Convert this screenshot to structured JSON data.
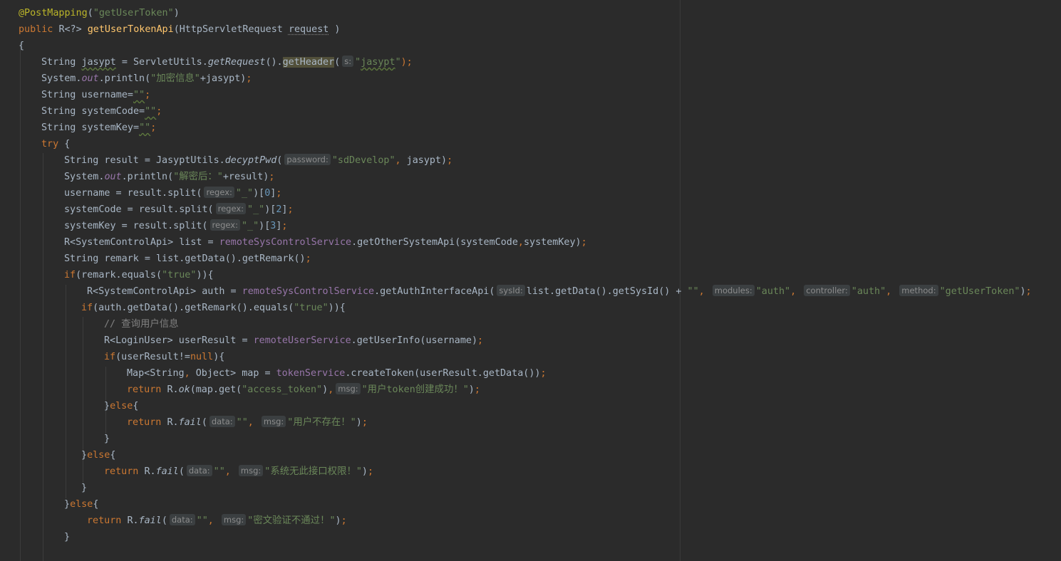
{
  "colors": {
    "background": "#2b2b2b",
    "default_text": "#a9b7c6",
    "keyword": "#cc7832",
    "string": "#6a8759",
    "number": "#6897bb",
    "annotation": "#bbb529",
    "field": "#9876aa",
    "method_declaration": "#ffc66d",
    "comment": "#808080",
    "inlay_hint_background": "#3b3f41"
  },
  "lines": [
    {
      "indent": 26,
      "tokens": [
        {
          "t": "@PostMapping",
          "c": "ann"
        },
        {
          "t": "(",
          "c": ""
        },
        {
          "t": "\"getUserToken\"",
          "c": "str"
        },
        {
          "t": ")",
          "c": ""
        }
      ]
    },
    {
      "indent": 26,
      "tokens": [
        {
          "t": "public ",
          "c": "kw"
        },
        {
          "t": "R<?> ",
          "c": ""
        },
        {
          "t": "getUserTokenApi",
          "c": "meth"
        },
        {
          "t": "(HttpServletRequest ",
          "c": ""
        },
        {
          "t": "request",
          "c": "dot"
        },
        {
          "t": " )",
          "c": ""
        }
      ]
    },
    {
      "indent": 26,
      "tokens": [
        {
          "t": "{",
          "c": ""
        }
      ]
    },
    {
      "indent": 58,
      "tokens": [
        {
          "t": "String ",
          "c": ""
        },
        {
          "t": "jasypt",
          "c": "wavy"
        },
        {
          "t": " = ServletUtils.",
          "c": ""
        },
        {
          "t": "getRequest",
          "c": "it"
        },
        {
          "t": "().",
          "c": ""
        },
        {
          "t": "getHeader",
          "c": "hl"
        },
        {
          "t": "(",
          "c": ""
        },
        {
          "h": "s:"
        },
        {
          "t": "\"",
          "c": "str"
        },
        {
          "t": "jasypt",
          "c": "str wavy"
        },
        {
          "t": "\"",
          "c": "str"
        },
        {
          "t": ");",
          "c": "kw"
        }
      ]
    },
    {
      "indent": 58,
      "tokens": [
        {
          "t": "System.",
          "c": ""
        },
        {
          "t": "out",
          "c": "fldi"
        },
        {
          "t": ".println(",
          "c": ""
        },
        {
          "t": "\"加密信息\"",
          "c": "str"
        },
        {
          "t": "+jasypt)",
          "c": ""
        },
        {
          "t": ";",
          "c": "kw"
        }
      ]
    },
    {
      "indent": 58,
      "tokens": [
        {
          "t": "String username=",
          "c": ""
        },
        {
          "t": "\"\"",
          "c": "str wavy"
        },
        {
          "t": ";",
          "c": "kw"
        }
      ]
    },
    {
      "indent": 58,
      "tokens": [
        {
          "t": "String systemCode=",
          "c": ""
        },
        {
          "t": "\"\"",
          "c": "str wavy"
        },
        {
          "t": ";",
          "c": "kw"
        }
      ]
    },
    {
      "indent": 58,
      "tokens": [
        {
          "t": "String systemKey=",
          "c": ""
        },
        {
          "t": "\"\"",
          "c": "str wavy"
        },
        {
          "t": ";",
          "c": "kw"
        }
      ]
    },
    {
      "indent": 58,
      "tokens": [
        {
          "t": "try ",
          "c": "kw"
        },
        {
          "t": "{",
          "c": ""
        }
      ]
    },
    {
      "indent": 90,
      "tokens": [
        {
          "t": "String result = JasyptUtils.",
          "c": ""
        },
        {
          "t": "decyptPwd",
          "c": "it"
        },
        {
          "t": "(",
          "c": ""
        },
        {
          "h": "password:"
        },
        {
          "t": "\"sdDevelop\"",
          "c": "str"
        },
        {
          "t": ", ",
          "c": "kw"
        },
        {
          "t": "jasypt)",
          "c": ""
        },
        {
          "t": ";",
          "c": "kw"
        }
      ]
    },
    {
      "indent": 90,
      "tokens": [
        {
          "t": "System.",
          "c": ""
        },
        {
          "t": "out",
          "c": "fldi"
        },
        {
          "t": ".println(",
          "c": ""
        },
        {
          "t": "\"解密后：\"",
          "c": "str"
        },
        {
          "t": "+result)",
          "c": ""
        },
        {
          "t": ";",
          "c": "kw"
        }
      ]
    },
    {
      "indent": 90,
      "tokens": [
        {
          "t": "username = result.split(",
          "c": ""
        },
        {
          "h": "regex:"
        },
        {
          "t": "\"_\"",
          "c": "str"
        },
        {
          "t": ")[",
          "c": ""
        },
        {
          "t": "0",
          "c": "num"
        },
        {
          "t": "]",
          "c": ""
        },
        {
          "t": ";",
          "c": "kw"
        }
      ]
    },
    {
      "indent": 90,
      "tokens": [
        {
          "t": "systemCode = result.split(",
          "c": ""
        },
        {
          "h": "regex:"
        },
        {
          "t": "\"_\"",
          "c": "str"
        },
        {
          "t": ")[",
          "c": ""
        },
        {
          "t": "2",
          "c": "num"
        },
        {
          "t": "]",
          "c": ""
        },
        {
          "t": ";",
          "c": "kw"
        }
      ]
    },
    {
      "indent": 90,
      "tokens": [
        {
          "t": "systemKey = result.split(",
          "c": ""
        },
        {
          "h": "regex:"
        },
        {
          "t": "\"_\"",
          "c": "str"
        },
        {
          "t": ")[",
          "c": ""
        },
        {
          "t": "3",
          "c": "num"
        },
        {
          "t": "]",
          "c": ""
        },
        {
          "t": ";",
          "c": "kw"
        }
      ]
    },
    {
      "indent": 90,
      "tokens": [
        {
          "t": "R<SystemControlApi> list = ",
          "c": ""
        },
        {
          "t": "remoteSysControlService",
          "c": "fld"
        },
        {
          "t": ".getOtherSystemApi(systemCode",
          "c": ""
        },
        {
          "t": ",",
          "c": "kw"
        },
        {
          "t": "systemKey)",
          "c": ""
        },
        {
          "t": ";",
          "c": "kw"
        }
      ]
    },
    {
      "indent": 90,
      "tokens": [
        {
          "t": "String remark = list.getData().getRemark()",
          "c": ""
        },
        {
          "t": ";",
          "c": "kw"
        }
      ]
    },
    {
      "indent": 90,
      "tokens": [
        {
          "t": "if",
          "c": "kw"
        },
        {
          "t": "(remark.equals(",
          "c": ""
        },
        {
          "t": "\"true\"",
          "c": "str"
        },
        {
          "t": ")){",
          "c": ""
        }
      ]
    },
    {
      "indent": 122,
      "tokens": [
        {
          "t": "R<SystemControlApi> auth = ",
          "c": ""
        },
        {
          "t": "remoteSysControlService",
          "c": "fld"
        },
        {
          "t": ".getAuthInterfaceApi(",
          "c": ""
        },
        {
          "h": "sysId:"
        },
        {
          "t": "list.getData().getSysId() + ",
          "c": ""
        },
        {
          "t": "\"\"",
          "c": "str"
        },
        {
          "t": ", ",
          "c": "kw"
        },
        {
          "h": "modules:"
        },
        {
          "t": "\"auth\"",
          "c": "str"
        },
        {
          "t": ", ",
          "c": "kw"
        },
        {
          "h": "controller:"
        },
        {
          "t": "\"auth\"",
          "c": "str"
        },
        {
          "t": ", ",
          "c": "kw"
        },
        {
          "h": "method:"
        },
        {
          "t": "\"getUserToken\"",
          "c": "str"
        },
        {
          "t": ")",
          "c": ""
        },
        {
          "t": ";",
          "c": "kw"
        }
      ]
    },
    {
      "indent": 114,
      "tokens": [
        {
          "t": "if",
          "c": "kw"
        },
        {
          "t": "(auth.getData().getRemark().equals(",
          "c": ""
        },
        {
          "t": "\"true\"",
          "c": "str"
        },
        {
          "t": ")){",
          "c": ""
        }
      ]
    },
    {
      "indent": 146,
      "tokens": [
        {
          "t": "// 查询用户信息",
          "c": "cmt"
        }
      ]
    },
    {
      "indent": 146,
      "tokens": [
        {
          "t": "R<LoginUser> userResult = ",
          "c": ""
        },
        {
          "t": "remoteUserService",
          "c": "fld"
        },
        {
          "t": ".getUserInfo(username)",
          "c": ""
        },
        {
          "t": ";",
          "c": "kw"
        }
      ]
    },
    {
      "indent": 146,
      "tokens": [
        {
          "t": "if",
          "c": "kw"
        },
        {
          "t": "(userResult!=",
          "c": ""
        },
        {
          "t": "null",
          "c": "kw"
        },
        {
          "t": "){",
          "c": ""
        }
      ]
    },
    {
      "indent": 178,
      "tokens": [
        {
          "t": "Map<String",
          "c": ""
        },
        {
          "t": ", ",
          "c": "kw"
        },
        {
          "t": "Object> map = ",
          "c": ""
        },
        {
          "t": "tokenService",
          "c": "fld"
        },
        {
          "t": ".createToken(userResult.getData())",
          "c": ""
        },
        {
          "t": ";",
          "c": "kw"
        }
      ]
    },
    {
      "indent": 178,
      "tokens": [
        {
          "t": "return ",
          "c": "kw"
        },
        {
          "t": "R.",
          "c": ""
        },
        {
          "t": "ok",
          "c": "it"
        },
        {
          "t": "(map.get(",
          "c": ""
        },
        {
          "t": "\"access_token\"",
          "c": "str"
        },
        {
          "t": ")",
          "c": ""
        },
        {
          "t": ",",
          "c": "kw"
        },
        {
          "h": "msg:"
        },
        {
          "t": "\"用户token创建成功！\"",
          "c": "str"
        },
        {
          "t": ")",
          "c": ""
        },
        {
          "t": ";",
          "c": "kw"
        }
      ]
    },
    {
      "indent": 146,
      "tokens": [
        {
          "t": "}",
          "c": ""
        },
        {
          "t": "else",
          "c": "kw"
        },
        {
          "t": "{",
          "c": ""
        }
      ]
    },
    {
      "indent": 178,
      "tokens": [
        {
          "t": "return ",
          "c": "kw"
        },
        {
          "t": "R.",
          "c": ""
        },
        {
          "t": "fail",
          "c": "it"
        },
        {
          "t": "(",
          "c": ""
        },
        {
          "h": "data:"
        },
        {
          "t": "\"\"",
          "c": "str"
        },
        {
          "t": ", ",
          "c": "kw"
        },
        {
          "h": "msg:"
        },
        {
          "t": "\"用户不存在！\"",
          "c": "str"
        },
        {
          "t": ")",
          "c": ""
        },
        {
          "t": ";",
          "c": "kw"
        }
      ]
    },
    {
      "indent": 146,
      "tokens": [
        {
          "t": "}",
          "c": ""
        }
      ]
    },
    {
      "indent": 114,
      "tokens": [
        {
          "t": "}",
          "c": ""
        },
        {
          "t": "else",
          "c": "kw"
        },
        {
          "t": "{",
          "c": ""
        }
      ]
    },
    {
      "indent": 146,
      "tokens": [
        {
          "t": "return ",
          "c": "kw"
        },
        {
          "t": "R.",
          "c": ""
        },
        {
          "t": "fail",
          "c": "it"
        },
        {
          "t": "(",
          "c": ""
        },
        {
          "h": "data:"
        },
        {
          "t": "\"\"",
          "c": "str"
        },
        {
          "t": ", ",
          "c": "kw"
        },
        {
          "h": "msg:"
        },
        {
          "t": "\"系统无此接口权限！\"",
          "c": "str"
        },
        {
          "t": ")",
          "c": ""
        },
        {
          "t": ";",
          "c": "kw"
        }
      ]
    },
    {
      "indent": 114,
      "tokens": [
        {
          "t": "}",
          "c": ""
        }
      ]
    },
    {
      "indent": 90,
      "tokens": [
        {
          "t": "}",
          "c": ""
        },
        {
          "t": "else",
          "c": "kw"
        },
        {
          "t": "{",
          "c": ""
        }
      ]
    },
    {
      "indent": 122,
      "tokens": [
        {
          "t": "return ",
          "c": "kw"
        },
        {
          "t": "R.",
          "c": ""
        },
        {
          "t": "fail",
          "c": "it"
        },
        {
          "t": "(",
          "c": ""
        },
        {
          "h": "data:"
        },
        {
          "t": "\"\"",
          "c": "str"
        },
        {
          "t": ", ",
          "c": "kw"
        },
        {
          "h": "msg:"
        },
        {
          "t": "\"密文验证不通过！\"",
          "c": "str"
        },
        {
          "t": ")",
          "c": ""
        },
        {
          "t": ";",
          "c": "kw"
        }
      ]
    },
    {
      "indent": 90,
      "tokens": [
        {
          "t": "}",
          "c": ""
        }
      ]
    }
  ]
}
